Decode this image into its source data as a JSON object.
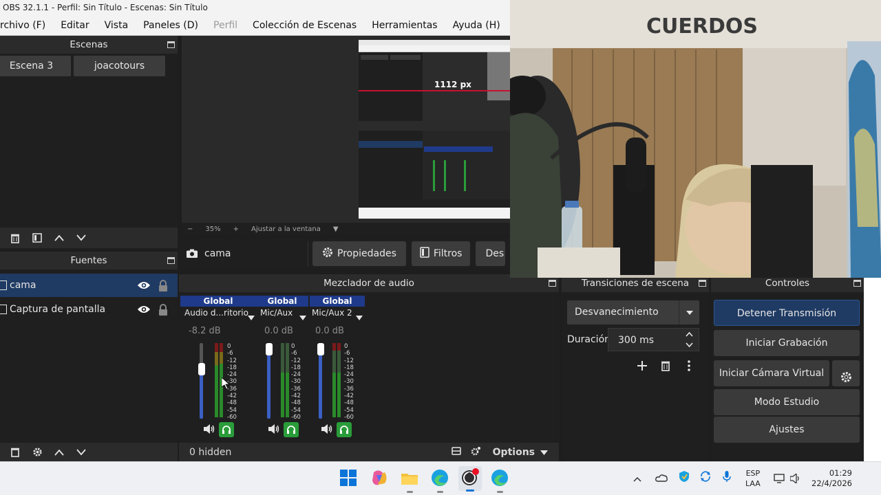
{
  "window": {
    "title": "OBS 32.1.1 - Perfil: Sin Título - Escenas: Sin Título"
  },
  "menu": [
    "rchivo (F)",
    "Editar",
    "Vista",
    "Paneles (D)",
    "Perfil",
    "Colección de Escenas",
    "Herramientas",
    "Ayuda (H)"
  ],
  "scenes": {
    "title": "Escenas",
    "items": [
      "Escena 3",
      "joacotours"
    ]
  },
  "sources": {
    "title": "Fuentes",
    "items": [
      "cama",
      "Captura de pantalla"
    ]
  },
  "preview": {
    "overlay_text": "1112 px",
    "zoom": "35%",
    "fit_label": "Ajustar a la ventana"
  },
  "source_toolbar": {
    "current": "cama",
    "properties": "Propiedades",
    "filters": "Filtros",
    "deactivate": "Des"
  },
  "mixer": {
    "title": "Mezclador de audio",
    "channels": [
      {
        "tag": "Global",
        "name": "Audio d...ritorio",
        "db": "-8.2 dB",
        "level": 0.68
      },
      {
        "tag": "Global",
        "name": "Mic/Aux",
        "db": "0.0 dB",
        "level": 1.0
      },
      {
        "tag": "Global",
        "name": "Mic/Aux 2",
        "db": "0.0 dB",
        "level": 1.0
      }
    ],
    "scale": [
      "0",
      "-6",
      "-12",
      "-18",
      "-24",
      "-30",
      "-36",
      "-42",
      "-48",
      "-54",
      "-60"
    ],
    "hidden": "0 hidden",
    "options": "Options"
  },
  "transitions": {
    "title": "Transiciones de escena",
    "selected": "Desvanecimiento",
    "duration_label": "Duración",
    "duration": "300 ms"
  },
  "controls": {
    "title": "Controles",
    "stop_stream": "Detener Transmisión",
    "start_record": "Iniciar Grabación",
    "virtual_cam": "Iniciar Cámara Virtual",
    "studio_mode": "Modo Estudio",
    "settings": "Ajustes"
  },
  "camera": {
    "sign": "CUERDOS"
  },
  "taskbar": {
    "lang_top": "ESP",
    "lang_bottom": "LAA",
    "time": "01:29",
    "date": "22/4/2026"
  },
  "colors": {
    "accent": "#1f3a63",
    "global_tag": "#1f3a8a",
    "monitor_green": "#2a9d3a",
    "slider_blue": "#3b5fc4"
  }
}
